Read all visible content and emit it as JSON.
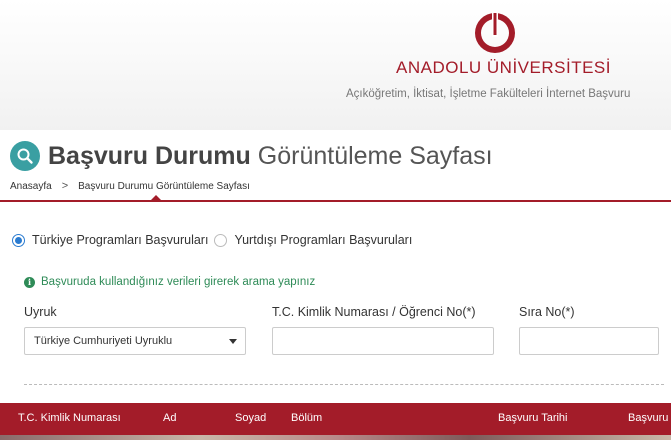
{
  "header": {
    "university_name": "ANADOLU ÜNİVERSİTESİ",
    "tagline": "Açıköğretim, İktisat, İşletme Fakülteleri İnternet Başvuru",
    "brand_color": "#a31c29",
    "logo_icon": "anadolu-logo-icon"
  },
  "page": {
    "title_bold": "Başvuru Durumu",
    "title_light": "Görüntüleme Sayfası",
    "title_icon": "search-icon"
  },
  "breadcrumb": {
    "home": "Anasayfa",
    "separator": ">",
    "current": "Başvuru Durumu Görüntüleme Sayfası"
  },
  "program_type": {
    "options": [
      {
        "label": "Türkiye Programları Başvuruları",
        "selected": true
      },
      {
        "label": "Yurtdışı Programları Başvuruları",
        "selected": false
      }
    ]
  },
  "info": {
    "message": "Başvuruda kullandığınız verileri girerek arama yapınız",
    "icon": "info-icon",
    "color": "#2e8b57"
  },
  "form": {
    "nationality_label": "Uyruk",
    "nationality_value": "Türkiye Cumhuriyeti Uyruklu",
    "id_label": "T.C. Kimlik Numarası / Öğrenci No(*)",
    "id_value": "",
    "order_label": "Sıra No(*)",
    "order_value": ""
  },
  "table": {
    "columns": [
      "T.C. Kimlik Numarası",
      "Ad",
      "Soyad",
      "Bölüm",
      "Başvuru Tarihi",
      "Başvuru"
    ]
  }
}
